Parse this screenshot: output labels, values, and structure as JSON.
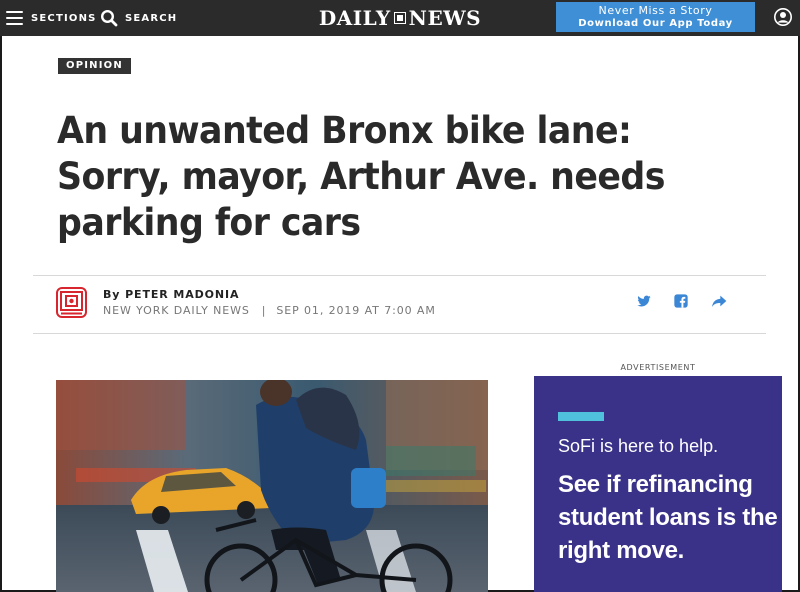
{
  "nav": {
    "sections_label": "SECTIONS",
    "search_label": "SEARCH",
    "logo_left": "DAILY",
    "logo_right": "NEWS",
    "app_cta_line1": "Never Miss a Story",
    "app_cta_line2": "Download Our App Today",
    "icons": {
      "menu": "hamburger-icon",
      "search": "search-icon",
      "profile": "user-profile-icon"
    }
  },
  "article": {
    "section_tag": "OPINION",
    "headline": "An unwanted Bronx bike lane: Sorry, mayor, Arthur Ave. needs parking for cars",
    "byline_prefix": "By",
    "author": "PETER MADONIA",
    "publication": "NEW YORK DAILY NEWS",
    "separator": "|",
    "date": "SEP 01, 2019 AT 7:00 AM",
    "share": [
      "twitter-icon",
      "facebook-icon",
      "share-arrow-icon"
    ]
  },
  "ad": {
    "label": "ADVERTISEMENT",
    "intro": "SoFi is here to help.",
    "headline": "See if refinancing student loans is the right move."
  },
  "colors": {
    "topbar": "#2b2b2b",
    "cta_blue": "#3e8fd6",
    "ad_purple": "#3a3288",
    "ad_accent": "#4fc1dd",
    "share_blue": "#3b87d6",
    "author_logo_red": "#d8262f"
  }
}
